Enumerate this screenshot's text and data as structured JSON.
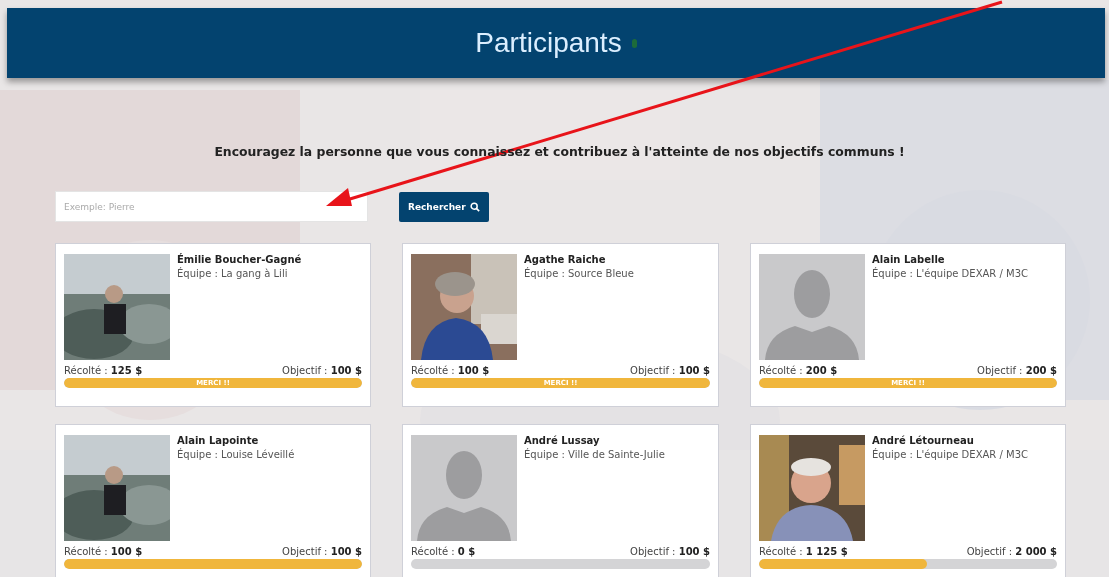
{
  "header": {
    "title": "Participants"
  },
  "intro": "Encouragez la personne que vous connaissez et contribuez à l'atteinte de nos objectifs communs !",
  "search": {
    "placeholder": "Exemple: Pierre",
    "button": "Rechercher"
  },
  "participants": [
    {
      "name": "Émilie Boucher-Gagné",
      "team": "Équipe : La gang à Lili",
      "raised_label": "Récolté :",
      "raised": "125 $",
      "goal_label": "Objectif :",
      "goal": "100 $",
      "level": 1,
      "bar_label": "MERCI !!"
    },
    {
      "name": "Agathe Raiche",
      "team": "Équipe : Source Bleue",
      "raised_label": "Récolté :",
      "raised": "100 $",
      "goal_label": "Objectif :",
      "goal": "100 $",
      "level": 1,
      "bar_label": "MERCI !!"
    },
    {
      "name": "Alain Labelle",
      "team": "Équipe : L'équipe DEXAR / M3C",
      "photo": {
        "kind": "silhouette"
      },
      "raised_label": "Récolté :",
      "raised": "200 $",
      "goal_label": "Objectif :",
      "goal": "200 $",
      "level": 1,
      "bar_label": "MERCI !!"
    },
    {
      "name": "Alain Lapointe",
      "team": "Équipe : Louise Léveillé",
      "raised_label": "Récolté :",
      "raised": "100 $",
      "goal_label": "Objectif :",
      "goal": "100 $",
      "level": 1
    },
    {
      "name": "André Lussay",
      "team": "Équipe : Ville de Sainte-Julie",
      "photo": {
        "kind": "silhouette"
      },
      "raised_label": "Récolté :",
      "raised": "0 $",
      "goal_label": "Objectif :",
      "goal": "100 $",
      "level": 0
    },
    {
      "name": "André Létourneau",
      "team": "Équipe : L'équipe DEXAR / M3C",
      "raised_label": "Récolté :",
      "raised": "1 125 $",
      "goal_label": "Objectif :",
      "goal": "2 000 $",
      "level": 0.5625
    }
  ]
}
